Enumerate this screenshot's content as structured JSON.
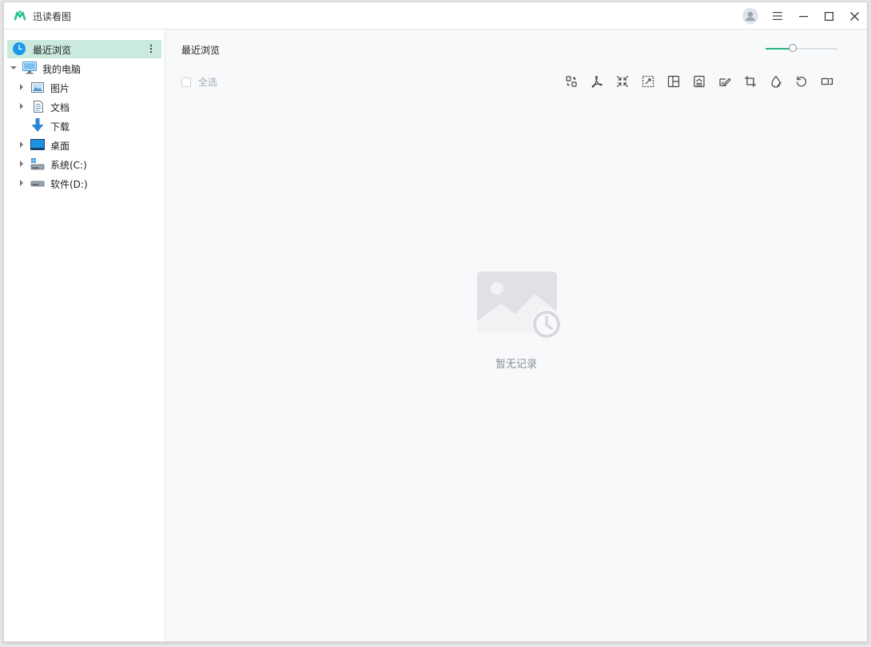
{
  "app": {
    "title": "迅读看图"
  },
  "sidebar": {
    "items": [
      {
        "label": "最近浏览"
      },
      {
        "label": "我的电脑"
      },
      {
        "label": "图片"
      },
      {
        "label": "文档"
      },
      {
        "label": "下载"
      },
      {
        "label": "桌面"
      },
      {
        "label": "系统(C:)"
      },
      {
        "label": "软件(D:)"
      }
    ]
  },
  "main": {
    "section_title": "最近浏览",
    "select_all_label": "全选",
    "zoom_level": 0.38,
    "empty_text": "暂无记录"
  },
  "toolbar": {
    "icons": [
      "convert-icon",
      "pdf-icon",
      "compress-icon",
      "resize-icon",
      "collage-icon",
      "image-text-icon",
      "edit-icon",
      "crop-icon",
      "watermark-icon",
      "rotate-icon",
      "more-icon"
    ]
  },
  "colors": {
    "accent": "#27b47e",
    "active_bg": "#c9eadd",
    "recent_icon": "#1a97ee"
  }
}
